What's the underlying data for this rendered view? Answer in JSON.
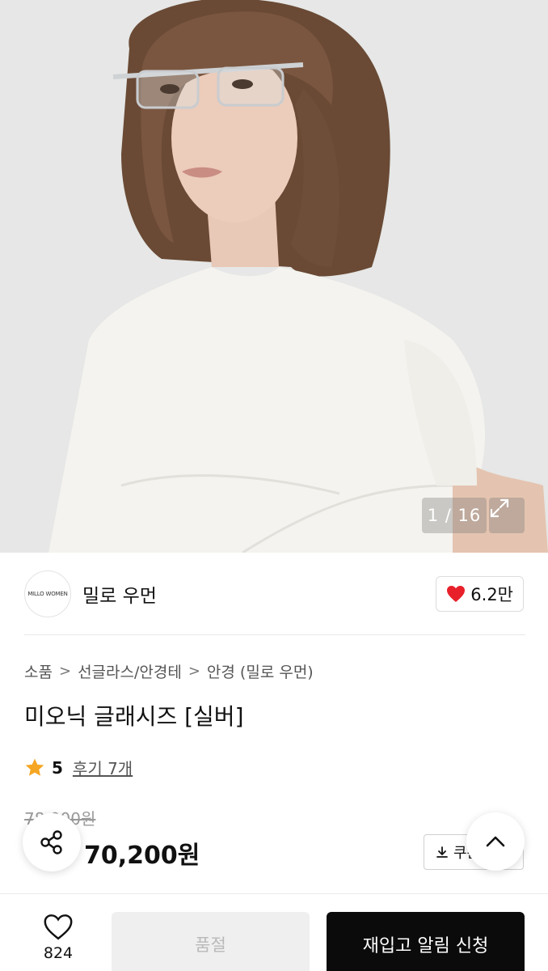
{
  "gallery": {
    "counter": "1 / 16",
    "expand_icon": "expand-arrows-icon"
  },
  "brand": {
    "logo_text": "MILLO WOMEN",
    "name": "밀로 우먼",
    "likes": "6.2만",
    "like_icon": "heart-filled-icon",
    "accent_color": "#e8202a"
  },
  "breadcrumb": {
    "items": [
      "소품",
      "선글라스/안경테",
      "안경 (밀로 우먼)"
    ]
  },
  "product": {
    "title": "미오닉 글래시즈 [실버]",
    "rating": "5",
    "reviews": "후기 7개",
    "original_price": "78,000원",
    "sale_price": "70,200원",
    "coupon_label": "쿠폰"
  },
  "bottom": {
    "wish_count": "824",
    "soldout_label": "품절",
    "restock_label": "재입고 알림 신청"
  }
}
